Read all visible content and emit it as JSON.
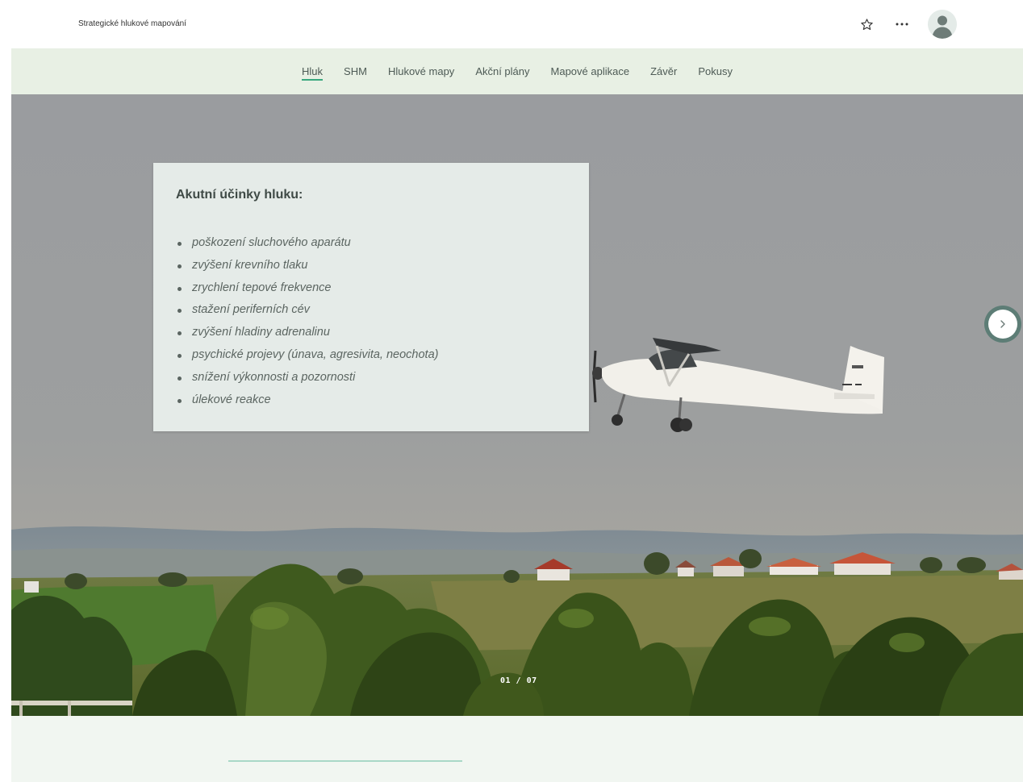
{
  "header": {
    "site_title": "Strategické hlukové mapování",
    "icons": [
      "star-icon",
      "more-icon",
      "avatar-icon"
    ],
    "more_label": "···"
  },
  "nav": {
    "items": [
      {
        "label": "Hluk",
        "active": true
      },
      {
        "label": "SHM",
        "active": false
      },
      {
        "label": "Hlukové mapy",
        "active": false
      },
      {
        "label": "Akční plány",
        "active": false
      },
      {
        "label": "Mapové aplikace",
        "active": false
      },
      {
        "label": "Závěr",
        "active": false
      },
      {
        "label": "Pokusy",
        "active": false
      }
    ]
  },
  "slide": {
    "heading": "Akutní účinky hluku:",
    "bullets": [
      "poškození sluchového aparátu",
      "zvýšení krevního tlaku",
      "zrychlení tepové frekvence",
      "stažení periferních cév",
      "zvýšení hladiny adrenalinu",
      "psychické projevy (únava, agresivita, neochota)",
      "snížení výkonnosti a pozornosti",
      "úlekové reakce"
    ],
    "counter": "01 / 07",
    "next_icon": "chevron-right-icon"
  },
  "colors": {
    "accent": "#39a77e",
    "nav_background": "#e8f0e4",
    "card_background": "#e8eeeb",
    "bottom_background": "#f1f6f1"
  }
}
